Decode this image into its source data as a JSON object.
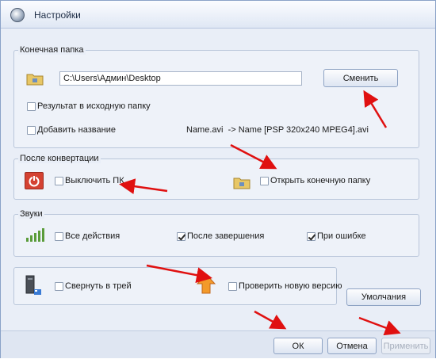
{
  "window": {
    "title": "Настройки"
  },
  "target_folder": {
    "legend": "Конечная папка",
    "path_value": "C:\\Users\\Админ\\Desktop",
    "change_button": "Сменить",
    "result_to_source": {
      "label": "Результат в исходную папку",
      "checked": false
    },
    "add_name": {
      "label": "Добавить название",
      "checked": false
    },
    "name_example": "Name.avi  -> Name [PSP 320x240 MPEG4].avi"
  },
  "after_conversion": {
    "legend": "После конвертации",
    "shutdown": {
      "label": "Выключить ПК",
      "checked": false
    },
    "open_folder": {
      "label": "Открыть конечную папку",
      "checked": false
    }
  },
  "sounds": {
    "legend": "Звуки",
    "all_actions": {
      "label": "Все действия",
      "checked": false
    },
    "after_finish": {
      "label": "После завершения",
      "checked": true
    },
    "on_error": {
      "label": "При ошибке",
      "checked": true
    }
  },
  "misc": {
    "minimize_tray": {
      "label": "Свернуть в трей",
      "checked": false
    },
    "check_update": {
      "label": "Проверить новую версию",
      "checked": false
    },
    "defaults_button": "Умолчания"
  },
  "footer": {
    "ok": "ОК",
    "cancel": "Отмена",
    "apply": "Применить"
  },
  "colors": {
    "annotation_arrow": "#e01010",
    "accent": "#c23a2b"
  }
}
